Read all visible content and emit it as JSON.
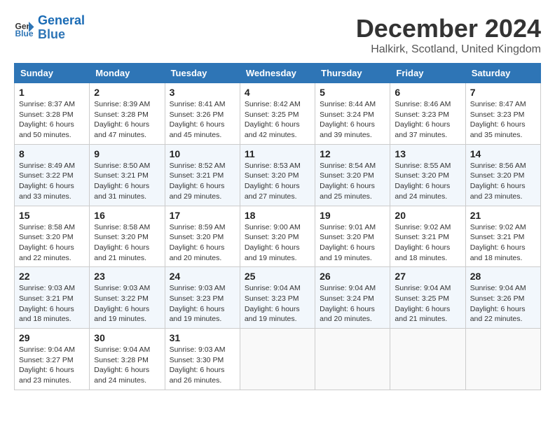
{
  "logo": {
    "line1": "General",
    "line2": "Blue"
  },
  "title": "December 2024",
  "subtitle": "Halkirk, Scotland, United Kingdom",
  "colors": {
    "header_bg": "#2e75b6",
    "accent": "#1a6bb5"
  },
  "weekdays": [
    "Sunday",
    "Monday",
    "Tuesday",
    "Wednesday",
    "Thursday",
    "Friday",
    "Saturday"
  ],
  "weeks": [
    [
      {
        "day": "1",
        "sunrise": "Sunrise: 8:37 AM",
        "sunset": "Sunset: 3:28 PM",
        "daylight": "Daylight: 6 hours and 50 minutes."
      },
      {
        "day": "2",
        "sunrise": "Sunrise: 8:39 AM",
        "sunset": "Sunset: 3:28 PM",
        "daylight": "Daylight: 6 hours and 47 minutes."
      },
      {
        "day": "3",
        "sunrise": "Sunrise: 8:41 AM",
        "sunset": "Sunset: 3:26 PM",
        "daylight": "Daylight: 6 hours and 45 minutes."
      },
      {
        "day": "4",
        "sunrise": "Sunrise: 8:42 AM",
        "sunset": "Sunset: 3:25 PM",
        "daylight": "Daylight: 6 hours and 42 minutes."
      },
      {
        "day": "5",
        "sunrise": "Sunrise: 8:44 AM",
        "sunset": "Sunset: 3:24 PM",
        "daylight": "Daylight: 6 hours and 39 minutes."
      },
      {
        "day": "6",
        "sunrise": "Sunrise: 8:46 AM",
        "sunset": "Sunset: 3:23 PM",
        "daylight": "Daylight: 6 hours and 37 minutes."
      },
      {
        "day": "7",
        "sunrise": "Sunrise: 8:47 AM",
        "sunset": "Sunset: 3:23 PM",
        "daylight": "Daylight: 6 hours and 35 minutes."
      }
    ],
    [
      {
        "day": "8",
        "sunrise": "Sunrise: 8:49 AM",
        "sunset": "Sunset: 3:22 PM",
        "daylight": "Daylight: 6 hours and 33 minutes."
      },
      {
        "day": "9",
        "sunrise": "Sunrise: 8:50 AM",
        "sunset": "Sunset: 3:21 PM",
        "daylight": "Daylight: 6 hours and 31 minutes."
      },
      {
        "day": "10",
        "sunrise": "Sunrise: 8:52 AM",
        "sunset": "Sunset: 3:21 PM",
        "daylight": "Daylight: 6 hours and 29 minutes."
      },
      {
        "day": "11",
        "sunrise": "Sunrise: 8:53 AM",
        "sunset": "Sunset: 3:20 PM",
        "daylight": "Daylight: 6 hours and 27 minutes."
      },
      {
        "day": "12",
        "sunrise": "Sunrise: 8:54 AM",
        "sunset": "Sunset: 3:20 PM",
        "daylight": "Daylight: 6 hours and 25 minutes."
      },
      {
        "day": "13",
        "sunrise": "Sunrise: 8:55 AM",
        "sunset": "Sunset: 3:20 PM",
        "daylight": "Daylight: 6 hours and 24 minutes."
      },
      {
        "day": "14",
        "sunrise": "Sunrise: 8:56 AM",
        "sunset": "Sunset: 3:20 PM",
        "daylight": "Daylight: 6 hours and 23 minutes."
      }
    ],
    [
      {
        "day": "15",
        "sunrise": "Sunrise: 8:58 AM",
        "sunset": "Sunset: 3:20 PM",
        "daylight": "Daylight: 6 hours and 22 minutes."
      },
      {
        "day": "16",
        "sunrise": "Sunrise: 8:58 AM",
        "sunset": "Sunset: 3:20 PM",
        "daylight": "Daylight: 6 hours and 21 minutes."
      },
      {
        "day": "17",
        "sunrise": "Sunrise: 8:59 AM",
        "sunset": "Sunset: 3:20 PM",
        "daylight": "Daylight: 6 hours and 20 minutes."
      },
      {
        "day": "18",
        "sunrise": "Sunrise: 9:00 AM",
        "sunset": "Sunset: 3:20 PM",
        "daylight": "Daylight: 6 hours and 19 minutes."
      },
      {
        "day": "19",
        "sunrise": "Sunrise: 9:01 AM",
        "sunset": "Sunset: 3:20 PM",
        "daylight": "Daylight: 6 hours and 19 minutes."
      },
      {
        "day": "20",
        "sunrise": "Sunrise: 9:02 AM",
        "sunset": "Sunset: 3:21 PM",
        "daylight": "Daylight: 6 hours and 18 minutes."
      },
      {
        "day": "21",
        "sunrise": "Sunrise: 9:02 AM",
        "sunset": "Sunset: 3:21 PM",
        "daylight": "Daylight: 6 hours and 18 minutes."
      }
    ],
    [
      {
        "day": "22",
        "sunrise": "Sunrise: 9:03 AM",
        "sunset": "Sunset: 3:21 PM",
        "daylight": "Daylight: 6 hours and 18 minutes."
      },
      {
        "day": "23",
        "sunrise": "Sunrise: 9:03 AM",
        "sunset": "Sunset: 3:22 PM",
        "daylight": "Daylight: 6 hours and 19 minutes."
      },
      {
        "day": "24",
        "sunrise": "Sunrise: 9:03 AM",
        "sunset": "Sunset: 3:23 PM",
        "daylight": "Daylight: 6 hours and 19 minutes."
      },
      {
        "day": "25",
        "sunrise": "Sunrise: 9:04 AM",
        "sunset": "Sunset: 3:23 PM",
        "daylight": "Daylight: 6 hours and 19 minutes."
      },
      {
        "day": "26",
        "sunrise": "Sunrise: 9:04 AM",
        "sunset": "Sunset: 3:24 PM",
        "daylight": "Daylight: 6 hours and 20 minutes."
      },
      {
        "day": "27",
        "sunrise": "Sunrise: 9:04 AM",
        "sunset": "Sunset: 3:25 PM",
        "daylight": "Daylight: 6 hours and 21 minutes."
      },
      {
        "day": "28",
        "sunrise": "Sunrise: 9:04 AM",
        "sunset": "Sunset: 3:26 PM",
        "daylight": "Daylight: 6 hours and 22 minutes."
      }
    ],
    [
      {
        "day": "29",
        "sunrise": "Sunrise: 9:04 AM",
        "sunset": "Sunset: 3:27 PM",
        "daylight": "Daylight: 6 hours and 23 minutes."
      },
      {
        "day": "30",
        "sunrise": "Sunrise: 9:04 AM",
        "sunset": "Sunset: 3:28 PM",
        "daylight": "Daylight: 6 hours and 24 minutes."
      },
      {
        "day": "31",
        "sunrise": "Sunrise: 9:03 AM",
        "sunset": "Sunset: 3:30 PM",
        "daylight": "Daylight: 6 hours and 26 minutes."
      },
      null,
      null,
      null,
      null
    ]
  ]
}
